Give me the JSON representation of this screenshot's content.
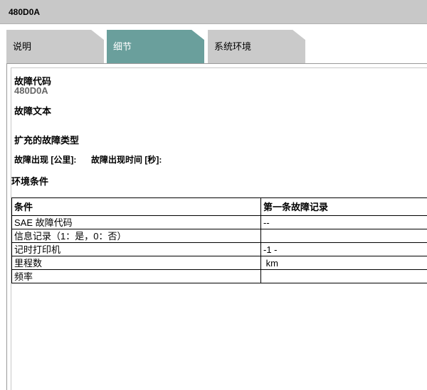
{
  "window": {
    "title": "480D0A"
  },
  "tabs": [
    {
      "label": "说明",
      "active": false
    },
    {
      "label": "细节",
      "active": true
    },
    {
      "label": "系统环境",
      "active": false
    }
  ],
  "details": {
    "fault_code_label": "故障代码",
    "fault_code_value": "480D0A",
    "fault_text_label": "故障文本",
    "extended_type_label": "扩充的故障类型",
    "occurrence_km_label": "故障出现 [公里]:",
    "occurrence_time_label": "故障出现时间 [秒]:",
    "env_conditions_label": "环境条件"
  },
  "env_table": {
    "headers": [
      "条件",
      "第一条故障记录"
    ],
    "rows": [
      [
        "SAE 故障代码",
        "--"
      ],
      [
        "信息记录（1：是，0：否）",
        ""
      ],
      [
        "记时打印机",
        "-1 -"
      ],
      [
        "里程数",
        " km"
      ],
      [
        "频率",
        ""
      ]
    ]
  },
  "colors": {
    "active_tab": "#6a9f9c",
    "inactive_tab": "#cacaca",
    "titlebar": "#c8c8c8"
  }
}
